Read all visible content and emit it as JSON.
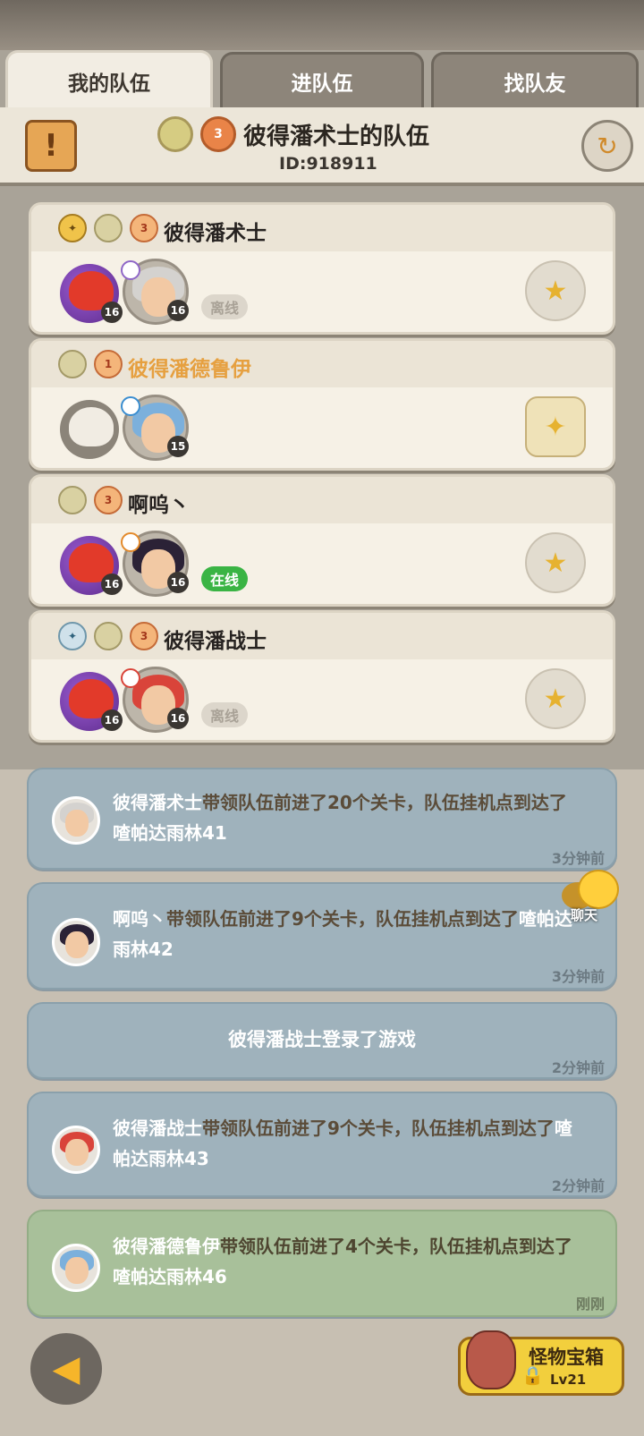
{
  "tabs": [
    {
      "label": "我的队伍",
      "active": true
    },
    {
      "label": "进队伍",
      "active": false
    },
    {
      "label": "找队友",
      "active": false
    }
  ],
  "header": {
    "notice_icon": "!",
    "team_title": "彼得潘术士的队伍",
    "team_id": "ID:918911",
    "badge_1": "",
    "badge_2": "3",
    "refresh_icon": "↻"
  },
  "members": [
    {
      "name": "彼得潘术士",
      "badge_rank": "3",
      "pet_level": "16",
      "hero_level": "16",
      "status": "离线"
    },
    {
      "name": "彼得潘德鲁伊",
      "badge_rank": "1",
      "pet_level": "",
      "hero_level": "15",
      "status": ""
    },
    {
      "name": "啊呜丶",
      "badge_rank": "3",
      "pet_level": "16",
      "hero_level": "16",
      "status": "在线"
    },
    {
      "name": "彼得潘战士",
      "badge_rank": "3",
      "pet_level": "16",
      "hero_level": "16",
      "status": "离线"
    }
  ],
  "logs": [
    {
      "name": "彼得潘术士",
      "text": "带领队伍前进了20个关卡，队伍挂机点到达了",
      "place": "喳帕达雨林41",
      "time": "3分钟前"
    },
    {
      "name": "啊呜丶",
      "text": "带领队伍前进了9个关卡，队伍挂机点到达了",
      "place": "喳帕达雨林42",
      "time": "3分钟前"
    },
    {
      "center": "彼得潘战士登录了游戏",
      "time": "2分钟前"
    },
    {
      "name": "彼得潘战士",
      "text": "带领队伍前进了9个关卡，队伍挂机点到达了",
      "place": "喳帕达雨林43",
      "time": "2分钟前"
    },
    {
      "name": "彼得潘德鲁伊",
      "text": "带领队伍前进了4个关卡，队伍挂机点到达了",
      "place": "喳帕达雨林46",
      "time": "刚刚"
    }
  ],
  "chat": {
    "label": "聊天"
  },
  "bottom": {
    "back_icon": "◀",
    "monster_box_title": "怪物宝箱",
    "monster_box_level": "Lv21",
    "lock_icon": "🔒"
  }
}
